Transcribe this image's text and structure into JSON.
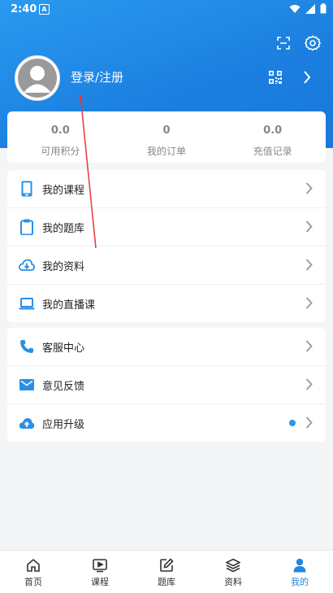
{
  "status": {
    "time": "2:40",
    "notif_letter": "A"
  },
  "header": {
    "login_label": "登录/注册"
  },
  "stats": [
    {
      "value": "0.0",
      "label": "可用积分"
    },
    {
      "value": "0",
      "label": "我的订单"
    },
    {
      "value": "0.0",
      "label": "充值记录"
    }
  ],
  "menu1": [
    {
      "label": "我的课程"
    },
    {
      "label": "我的题库"
    },
    {
      "label": "我的资料"
    },
    {
      "label": "我的直播课"
    }
  ],
  "menu2": [
    {
      "label": "客服中心"
    },
    {
      "label": "意见反馈"
    },
    {
      "label": "应用升级"
    }
  ],
  "tabs": [
    {
      "label": "首页"
    },
    {
      "label": "课程"
    },
    {
      "label": "题库"
    },
    {
      "label": "资料"
    },
    {
      "label": "我的"
    }
  ],
  "colors": {
    "accent": "#1e88e5",
    "header_top": "#2a9af0",
    "header_bottom": "#1a78d8",
    "badge_dot": "#2196f3"
  }
}
